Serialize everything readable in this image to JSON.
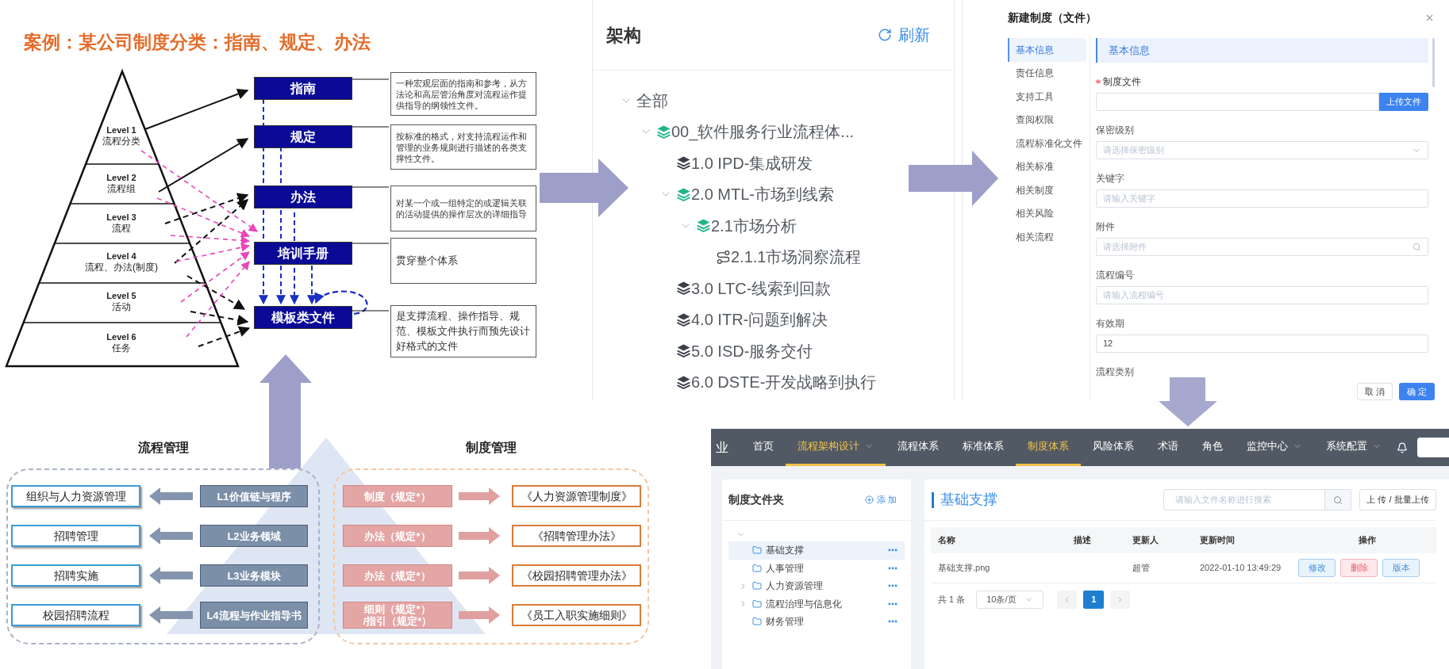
{
  "slide": {
    "title": "案例：某公司制度分类：指南、规定、办法",
    "levels": [
      {
        "label": "Level 1",
        "name": "流程分类"
      },
      {
        "label": "Level 2",
        "name": "流程组"
      },
      {
        "label": "Level 3",
        "name": "流程"
      },
      {
        "label": "Level 4",
        "name": "流程、办法(制度)"
      },
      {
        "label": "Level 5",
        "name": "活动"
      },
      {
        "label": "Level 6",
        "name": "任务"
      }
    ],
    "categories": [
      {
        "name": "指南",
        "description": "一种宏观层面的指南和参考，从方法论和高层管治角度对流程运作提供指导的纲领性文件。"
      },
      {
        "name": "规定",
        "description": "按标准的格式，对支持流程运作和管理的业务规则进行描述的各类支撑性文件。"
      },
      {
        "name": "办法",
        "description": "对某一个或一组特定的或逻辑关联的活动提供的操作层次的详细指导"
      },
      {
        "name": "培训手册",
        "description": "贯穿整个体系"
      },
      {
        "name": "模板类文件",
        "description": "是支撑流程、操作指导、规范、模板文件执行而预先设计好格式的文件"
      }
    ]
  },
  "mapping": {
    "process_title": "流程管理",
    "policy_title": "制度管理",
    "rows": [
      {
        "process": "组织与人力资源管理",
        "level": "L1价值链与程序",
        "policy": "制度（规定*）",
        "document": "《人力资源管理制度》"
      },
      {
        "process": "招聘管理",
        "level": "L2业务领域",
        "policy": "办法（规定*）",
        "document": "《招聘管理办法》"
      },
      {
        "process": "招聘实施",
        "level": "L3业务模块",
        "policy": "办法（规定*）",
        "document": "《校园招聘管理办法》"
      },
      {
        "process": "校园招聘流程",
        "level": "L4流程与作业指导书",
        "policy": "细则（规定*）\n/指引（规定*）",
        "document": "《员工入职实施细则》"
      }
    ]
  },
  "architecture": {
    "title": "架构",
    "refresh": "刷新",
    "tree": [
      {
        "label": "全部",
        "expanded": true,
        "children": [
          {
            "label": "00_软件服务行业流程体...",
            "kind": "group",
            "expanded": true,
            "children": [
              {
                "label": "1.0 IPD-集成研发",
                "kind": "group",
                "expanded": false
              },
              {
                "label": "2.0 MTL-市场到线索",
                "kind": "group",
                "expanded": true,
                "children": [
                  {
                    "label": "2.1市场分析",
                    "kind": "group",
                    "expanded": true,
                    "children": [
                      {
                        "label": "2.1.1市场洞察流程",
                        "kind": "process"
                      }
                    ]
                  }
                ]
              },
              {
                "label": "3.0 LTC-线索到回款",
                "kind": "group",
                "expanded": false
              },
              {
                "label": "4.0 ITR-问题到解决",
                "kind": "group",
                "expanded": false
              },
              {
                "label": "5.0 ISD-服务交付",
                "kind": "group",
                "expanded": false
              },
              {
                "label": "6.0 DSTE-开发战略到执行",
                "kind": "group",
                "expanded": false
              }
            ]
          }
        ]
      }
    ]
  },
  "dialog": {
    "title": "新建制度（文件）",
    "nav": [
      {
        "label": "基本信息",
        "selected": true
      },
      {
        "label": "责任信息",
        "selected": false
      },
      {
        "label": "支持工具",
        "selected": false
      },
      {
        "label": "查阅权限",
        "selected": false
      },
      {
        "label": "流程标准化文件",
        "selected": false
      },
      {
        "label": "相关标准",
        "selected": false
      },
      {
        "label": "相关制度",
        "selected": false
      },
      {
        "label": "相关风险",
        "selected": false
      },
      {
        "label": "相关流程",
        "selected": false
      }
    ],
    "section": "基本信息",
    "fields": [
      {
        "label": "制度文件",
        "required": true,
        "kind": "upload",
        "button": "上传文件"
      },
      {
        "label": "保密级别",
        "required": false,
        "kind": "select",
        "placeholder": "请选择保密级别"
      },
      {
        "label": "关键字",
        "required": false,
        "kind": "text",
        "placeholder": "请输入关键字"
      },
      {
        "label": "附件",
        "required": false,
        "kind": "search",
        "placeholder": "请选择附件"
      },
      {
        "label": "流程编号",
        "required": false,
        "kind": "text",
        "placeholder": "请输入流程编号"
      },
      {
        "label": "有效期",
        "required": false,
        "kind": "text",
        "value": "12"
      },
      {
        "label": "流程类别",
        "required": false,
        "kind": "label"
      }
    ],
    "buttons": [
      {
        "label": "取 消",
        "primary": false
      },
      {
        "label": "确 定",
        "primary": true
      }
    ]
  },
  "app": {
    "brand": "业",
    "menu": [
      {
        "label": "首页",
        "selected": false,
        "dropdown": false
      },
      {
        "label": "流程架构设计",
        "selected": true,
        "dropdown": true
      },
      {
        "label": "流程体系",
        "selected": false,
        "dropdown": false
      },
      {
        "label": "标准体系",
        "selected": false,
        "dropdown": false
      },
      {
        "label": "制度体系",
        "selected": true,
        "dropdown": false
      },
      {
        "label": "风险体系",
        "selected": false,
        "dropdown": false
      },
      {
        "label": "术语",
        "selected": false,
        "dropdown": false
      },
      {
        "label": "角色",
        "selected": false,
        "dropdown": false
      },
      {
        "label": "监控中心",
        "selected": false,
        "dropdown": true
      },
      {
        "label": "系统配置",
        "selected": false,
        "dropdown": true
      }
    ],
    "folder_panel": {
      "title": "制度文件夹",
      "add": "添 加",
      "root_expanded": true,
      "folders": [
        {
          "label": "基础支撑",
          "selected": true,
          "expandable": false
        },
        {
          "label": "人事管理",
          "selected": false,
          "expandable": false
        },
        {
          "label": "人力资源管理",
          "selected": false,
          "expandable": true
        },
        {
          "label": "流程治理与信息化",
          "selected": false,
          "expandable": true
        },
        {
          "label": "财务管理",
          "selected": false,
          "expandable": false
        }
      ]
    },
    "content": {
      "title": "基础支撑",
      "search_placeholder": "请输入文件名称进行搜索",
      "upload": "上 传 / 批量上传",
      "columns": [
        "名称",
        "描述",
        "更新人",
        "更新时间",
        "操作"
      ],
      "rows": [
        {
          "name": "基础支撑.png",
          "updater": "超管",
          "updated": "2022-01-10 13:49:29",
          "actions": [
            {
              "label": "修改",
              "kind": "info"
            },
            {
              "label": "删除",
              "kind": "danger"
            },
            {
              "label": "版本",
              "kind": "info"
            }
          ]
        }
      ],
      "pagination": {
        "total": "共 1 条",
        "page_size": "10条/页",
        "pages": [
          {
            "label": "1",
            "selected": true
          }
        ]
      }
    }
  }
}
